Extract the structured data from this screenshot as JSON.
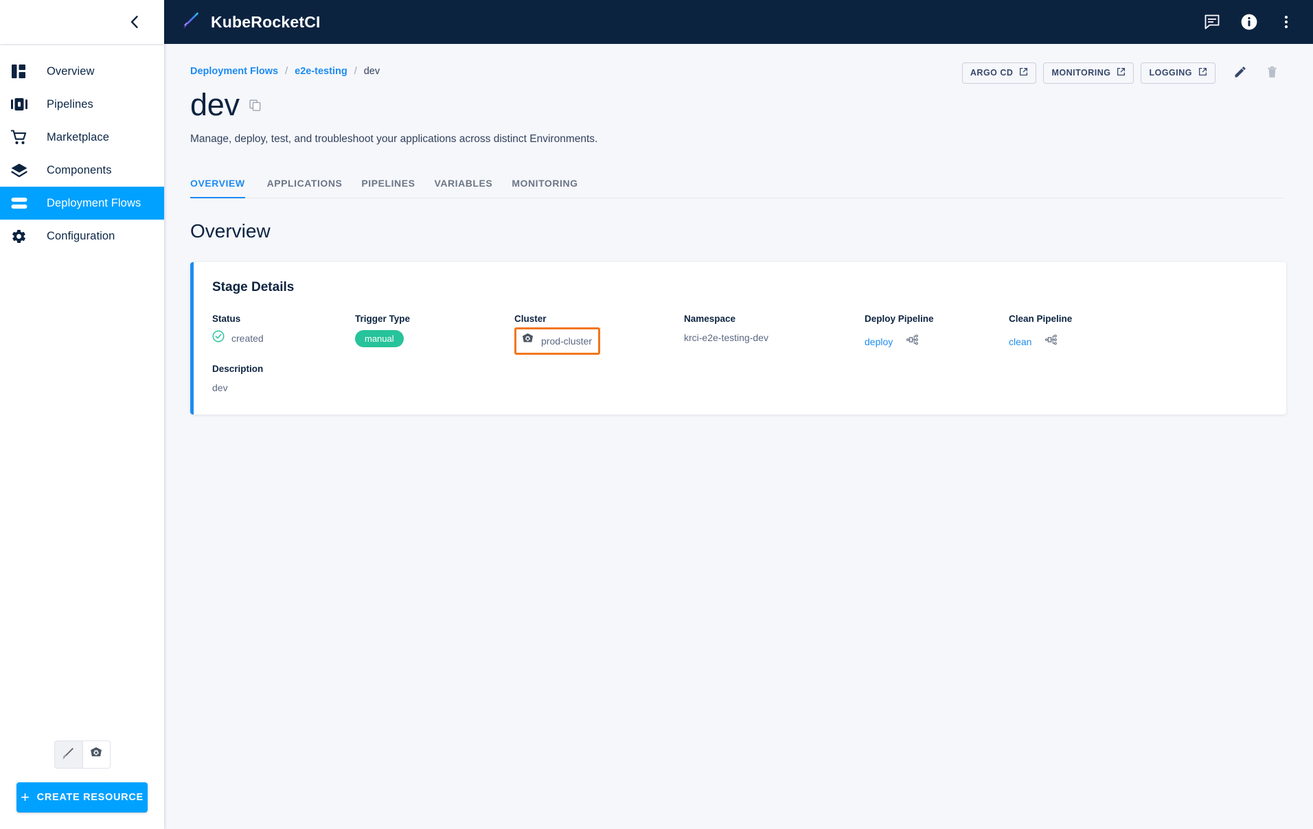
{
  "app": {
    "brand_title": "KubeRocketCI",
    "logo_icon": "rocket-pen-icon"
  },
  "topbar": {
    "icons": [
      {
        "name": "chat-icon",
        "label": "Chat"
      },
      {
        "name": "info-icon",
        "label": "Info"
      },
      {
        "name": "kebab-menu-icon",
        "label": "More"
      }
    ]
  },
  "sidebar": {
    "collapse_icon": "chevron-left-icon",
    "items": [
      {
        "label": "Overview",
        "icon": "dashboard-icon",
        "active": false
      },
      {
        "label": "Pipelines",
        "icon": "pipelines-icon",
        "active": false
      },
      {
        "label": "Marketplace",
        "icon": "cart-icon",
        "active": false
      },
      {
        "label": "Components",
        "icon": "layers-icon",
        "active": false
      },
      {
        "label": "Deployment Flows",
        "icon": "flows-icon",
        "active": true
      },
      {
        "label": "Configuration",
        "icon": "gear-icon",
        "active": false
      }
    ],
    "segmented": [
      {
        "name": "krci-view-button",
        "icon": "rocket-pen-icon",
        "selected": true
      },
      {
        "name": "kubernetes-view-button",
        "icon": "kubernetes-icon",
        "selected": false
      }
    ],
    "create_resource_label": "CREATE RESOURCE",
    "create_resource_plus": "+"
  },
  "breadcrumb": {
    "items": [
      {
        "label": "Deployment Flows",
        "link": true
      },
      {
        "label": "e2e-testing",
        "link": true
      },
      {
        "label": "dev",
        "link": false
      }
    ],
    "separator": "/"
  },
  "page": {
    "title": "dev",
    "copy_icon": "copy-icon",
    "subtitle": "Manage, deploy, test, and troubleshoot your applications across distinct Environments.",
    "section_title": "Overview"
  },
  "top_actions": {
    "buttons": [
      {
        "label": "ARGO CD",
        "icon": "external-link-icon"
      },
      {
        "label": "MONITORING",
        "icon": "external-link-icon"
      },
      {
        "label": "LOGGING",
        "icon": "external-link-icon"
      }
    ],
    "edit_icon": "pencil-icon",
    "delete_icon": "trash-icon"
  },
  "tabs": [
    {
      "label": "OVERVIEW",
      "active": true
    },
    {
      "label": "APPLICATIONS",
      "active": false
    },
    {
      "label": "PIPELINES",
      "active": false
    },
    {
      "label": "VARIABLES",
      "active": false
    },
    {
      "label": "MONITORING",
      "active": false
    }
  ],
  "stage_details": {
    "card_title": "Stage Details",
    "status": {
      "label": "Status",
      "value": "created",
      "icon": "check-circle-icon",
      "color": "#27c39a"
    },
    "trigger_type": {
      "label": "Trigger Type",
      "value": "manual",
      "badge_color": "#27c39a"
    },
    "cluster": {
      "label": "Cluster",
      "value": "prod-cluster",
      "icon": "kubernetes-icon",
      "highlight_color": "#f2761b"
    },
    "namespace": {
      "label": "Namespace",
      "value": "krci-e2e-testing-dev"
    },
    "deploy_pipeline": {
      "label": "Deploy Pipeline",
      "value": "deploy",
      "icon": "pipeline-tree-icon"
    },
    "clean_pipeline": {
      "label": "Clean Pipeline",
      "value": "clean",
      "icon": "pipeline-tree-icon"
    },
    "description": {
      "label": "Description",
      "value": "dev"
    }
  },
  "theme": {
    "accent": "#00a1ff",
    "link": "#1d8bf1",
    "header_bg": "#0c2340",
    "page_bg": "#f6f7fb",
    "success": "#27c39a",
    "highlight": "#f2761b"
  }
}
